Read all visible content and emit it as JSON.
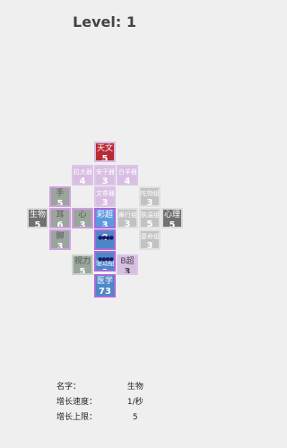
{
  "level_title": "Level: 1",
  "cells": {
    "tianwen": {
      "name": "天文",
      "value": "5"
    },
    "r2c1": {
      "name": "拉大器",
      "value": "4"
    },
    "r2c2": {
      "name": "安子器",
      "value": "3"
    },
    "r2c3": {
      "name": "白羊器",
      "value": "4"
    },
    "shou": {
      "name": "手",
      "value": "5"
    },
    "r3c2": {
      "name": "文章器",
      "value": "3"
    },
    "r3c4": {
      "name": "吃物组器",
      "value": "3"
    },
    "shengwu": {
      "name": "生物",
      "value": "5"
    },
    "er": {
      "name": "耳",
      "value": "6"
    },
    "xin": {
      "name": "心",
      "value": "3"
    },
    "ganjue": {
      "name": "彩超",
      "value": "3"
    },
    "r4c3": {
      "name": "鼻行组器",
      "value": "3"
    },
    "r4c4": {
      "name": "执温组器",
      "value": "5"
    },
    "xinli": {
      "name": "心理",
      "value": "5"
    },
    "r5c2": {
      "name": "",
      "value": "0"
    },
    "r5c4": {
      "name": "基命组器",
      "value": "3"
    },
    "jiao": {
      "name": "脚",
      "value": "3"
    },
    "r6c2": {
      "name": "驱动组器",
      "value": "3"
    },
    "shili": {
      "name": "视力",
      "value": "5"
    },
    "r7c1": {
      "name": "",
      "value": "3"
    },
    "bchao": {
      "name": "B超",
      "value": "3"
    },
    "yixue": {
      "name": "医学",
      "value": "73"
    }
  },
  "info": {
    "name_label": "名字：",
    "name_value": "生物",
    "speed_label": "增长速度：",
    "speed_value": "1/秒",
    "limit_label": "增长上限：",
    "limit_value": "5"
  },
  "colors": {
    "red": "#b82a36",
    "green": "#9aa59b",
    "blue": "#4d87c7",
    "purple_border": "#a56ad9",
    "pink": "#d8bee3"
  }
}
